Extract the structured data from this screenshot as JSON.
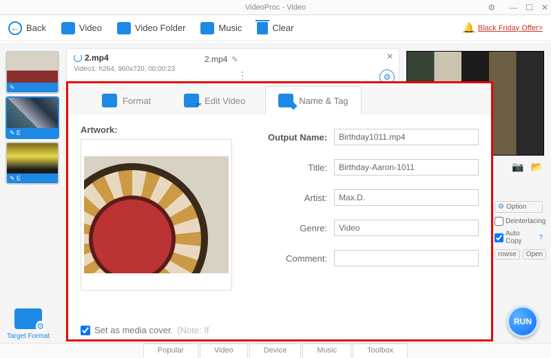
{
  "titlebar": {
    "title": "VideoProc - Video"
  },
  "toolbar": {
    "back": "Back",
    "video": "Video",
    "video_folder": "Video Folder",
    "music": "Music",
    "clear": "Clear",
    "offer": "Black Friday Offer>"
  },
  "thumbs": {
    "edit_label": "E"
  },
  "vidrow": {
    "filename": "2.mp4",
    "info": "Video1: h264, 960x720, 00:00:23",
    "mid_filename": "2.mp4"
  },
  "preview_icons": {
    "camera": "📷",
    "folder": "📂"
  },
  "options": {
    "option": "Option",
    "deinterlacing": "Deinterlacing",
    "autocopy": "Auto Copy",
    "browse": "rowse",
    "open": "Open"
  },
  "run": "RUN",
  "tabs": {
    "format": "Format",
    "edit_video": "Edit Video",
    "name_tag": "Name & Tag"
  },
  "panel": {
    "artwork_label": "Artwork:",
    "output_name_label": "Output Name:",
    "output_name": "Birthday1011.mp4",
    "title_label": "Title:",
    "title": "Birthday-Aaron-1011",
    "artist_label": "Artist:",
    "artist": "Max.D.",
    "genre_label": "Genre:",
    "genre": "Video",
    "comment_label": "Comment:",
    "comment": "",
    "media_cover": "Set as media cover.",
    "media_note": "(Note: If"
  },
  "target_format": "Target Format",
  "footer": {
    "popular": "Popular",
    "video": "Video",
    "device": "Device",
    "music": "Music",
    "toolbox": "Toolbox"
  }
}
